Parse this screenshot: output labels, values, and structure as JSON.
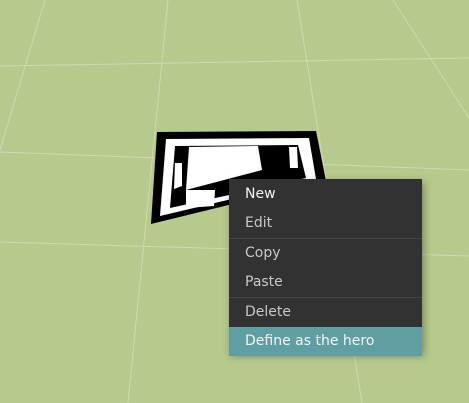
{
  "scene": {
    "ground_color": "#b7ca8d",
    "grid_line_color": "#cdd9b0",
    "object": {
      "outer_color": "#000000",
      "inner_color": "#ffffff"
    }
  },
  "context_menu": {
    "background": "#323232",
    "highlight_color": "#5f9ea2",
    "items": [
      {
        "label": "New"
      },
      {
        "label": "Edit"
      },
      {
        "label": "Copy"
      },
      {
        "label": "Paste"
      },
      {
        "label": "Delete"
      },
      {
        "label": "Define as the hero"
      }
    ]
  }
}
